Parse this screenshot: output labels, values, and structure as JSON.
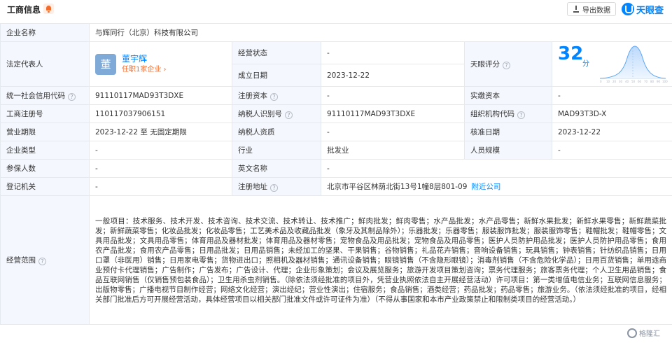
{
  "header": {
    "title": "工商信息",
    "export_label": "导出数据",
    "brand_name": "天眼查"
  },
  "rows": {
    "company_name": {
      "label": "企业名称",
      "value": "与辉同行（北京）科技有限公司"
    },
    "legal_rep": {
      "label": "法定代表人",
      "avatar": "董",
      "name": "董宇辉",
      "sub": "任职1家企业 ›"
    },
    "status": {
      "label": "经营状态",
      "value": "-"
    },
    "found_date": {
      "label": "成立日期",
      "value": "2023-12-22"
    },
    "score": {
      "label": "天眼评分",
      "value": "32",
      "unit": "分"
    },
    "credit_code": {
      "label": "统一社会信用代码",
      "value": "91110117MAD93T3DXE"
    },
    "reg_capital": {
      "label": "注册资本",
      "value": "-"
    },
    "paid_capital": {
      "label": "实缴资本",
      "value": "-"
    },
    "reg_number": {
      "label": "工商注册号",
      "value": "110117037906151"
    },
    "tax_id": {
      "label": "纳税人识别号",
      "value": "91110117MAD93T3DXE"
    },
    "org_code": {
      "label": "组织机构代码",
      "value": "MAD93T3D-X"
    },
    "term": {
      "label": "营业期限",
      "value": "2023-12-22 至 无固定期限"
    },
    "tax_qual": {
      "label": "纳税人资质",
      "value": "-"
    },
    "approve_date": {
      "label": "核准日期",
      "value": "2023-12-22"
    },
    "type": {
      "label": "企业类型",
      "value": "-"
    },
    "industry": {
      "label": "行业",
      "value": "批发业"
    },
    "staff_size": {
      "label": "人员规模",
      "value": "-"
    },
    "insured": {
      "label": "参保人数",
      "value": "-"
    },
    "en_name": {
      "label": "英文名称",
      "value": "-"
    },
    "authority": {
      "label": "登记机关",
      "value": "-"
    },
    "address": {
      "label": "注册地址",
      "value": "北京市平谷区林荫北街13号1幢8层801-09",
      "link": "附近公司"
    },
    "scope": {
      "label": "经营范围",
      "value": "一般项目：技术服务、技术开发、技术咨询、技术交流、技术转让、技术推广；鲜肉批发；鲜肉零售；水产品批发；水产品零售；新鲜水果批发；新鲜水果零售；新鲜蔬菜批发；新鲜蔬菜零售；化妆品批发；化妆品零售；工艺美术品及收藏品批发（象牙及其制品除外）；乐器批发；乐器零售；服装服饰批发；服装服饰零售；鞋帽批发；鞋帽零售；文具用品批发；文具用品零售；体育用品及器材批发；体育用品及器材零售；宠物食品及用品批发；宠物食品及用品零售；医护人员防护用品批发；医护人员防护用品零售；食用农产品批发；食用农产品零售；日用品批发；日用品销售；未经加工的坚果、干果销售；谷物销售；礼品花卉销售；音响设备销售；玩具销售；钟表销售；针纺织品销售；日用口罩（非医用）销售；日用家电零售；货物进出口；照相机及器材销售；通讯设备销售；眼镜销售（不含隐形眼镜）；消毒剂销售（不含危险化学品）；日用百货销售；单用途商业预付卡代理销售；广告制作；广告发布；广告设计、代理；企业形象策划；会议及展览服务；旅游开发项目策划咨询；票务代理服务；旅客票务代理；个人卫生用品销售；食品互联网销售（仅销售预包装食品）；卫生用杀虫剂销售。（除依法须经批准的项目外，凭营业执照依法自主开展经营活动）许可项目：第一类增值电信业务；互联网信息服务；出版物零售；广播电视节目制作经营；网络文化经营；演出经纪；营业性演出；住宿服务；食品销售；酒类经营；药品批发；药品零售；旅游业务。（依法须经批准的项目，经相关部门批准后方可开展经营活动，具体经营项目以相关部门批准文件或许可证件为准）（不得从事国家和本市产业政策禁止和限制类项目的经营活动。）"
    }
  },
  "watermark": "格隆汇",
  "colors": {
    "accent": "#0084ff",
    "label_bg": "#f4f7fd",
    "border": "#e4e8ef",
    "orange": "#f36b2b"
  }
}
